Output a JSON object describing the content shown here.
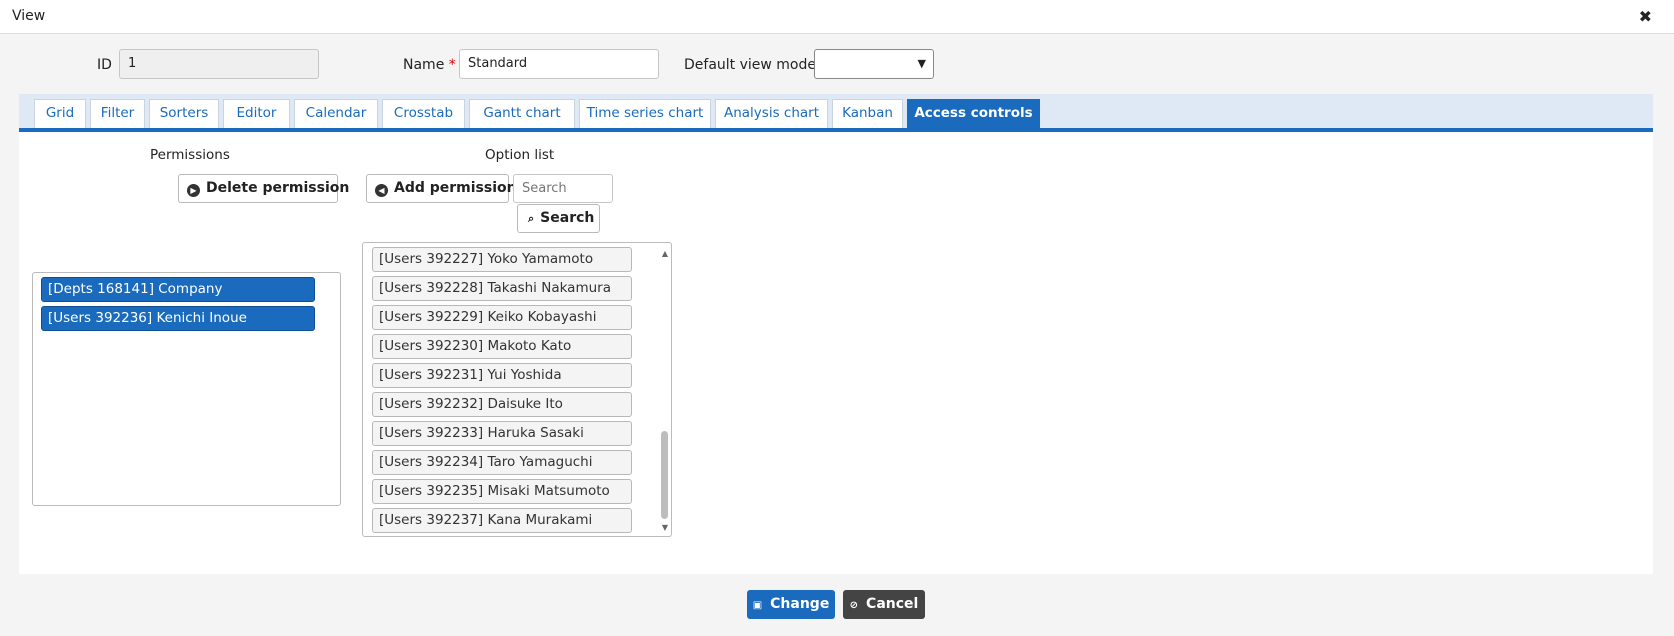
{
  "dialog": {
    "title": "View",
    "close_icon": "✖"
  },
  "form": {
    "id_label": "ID",
    "id_value": "1",
    "name_label": "Name",
    "name_required": "*",
    "name_value": "Standard",
    "default_view_mode_label": "Default view mode",
    "default_view_mode_value": ""
  },
  "tabs": [
    {
      "label": "Grid"
    },
    {
      "label": "Filter"
    },
    {
      "label": "Sorters"
    },
    {
      "label": "Editor"
    },
    {
      "label": "Calendar"
    },
    {
      "label": "Crosstab"
    },
    {
      "label": "Gantt chart"
    },
    {
      "label": "Time series chart"
    },
    {
      "label": "Analysis chart"
    },
    {
      "label": "Kanban"
    },
    {
      "label": "Access controls"
    }
  ],
  "access": {
    "permissions_heading": "Permissions",
    "option_list_heading": "Option list",
    "delete_permission_label": "Delete permission",
    "add_permission_label": "Add permission",
    "search_placeholder": "Search",
    "search_button_label": "Search",
    "permissions": [
      "[Depts 168141] Company",
      "[Users 392236] Kenichi Inoue"
    ],
    "options": [
      "[Users 392227] Yoko Yamamoto",
      "[Users 392228] Takashi Nakamura",
      "[Users 392229] Keiko Kobayashi",
      "[Users 392230] Makoto Kato",
      "[Users 392231] Yui Yoshida",
      "[Users 392232] Daisuke Ito",
      "[Users 392233] Haruka Sasaki",
      "[Users 392234] Taro Yamaguchi",
      "[Users 392235] Misaki Matsumoto",
      "[Users 392237] Kana Murakami"
    ]
  },
  "footer": {
    "change_label": "Change",
    "cancel_label": "Cancel"
  },
  "colors": {
    "accent": "#1a6bbd",
    "cancel": "#444444"
  }
}
